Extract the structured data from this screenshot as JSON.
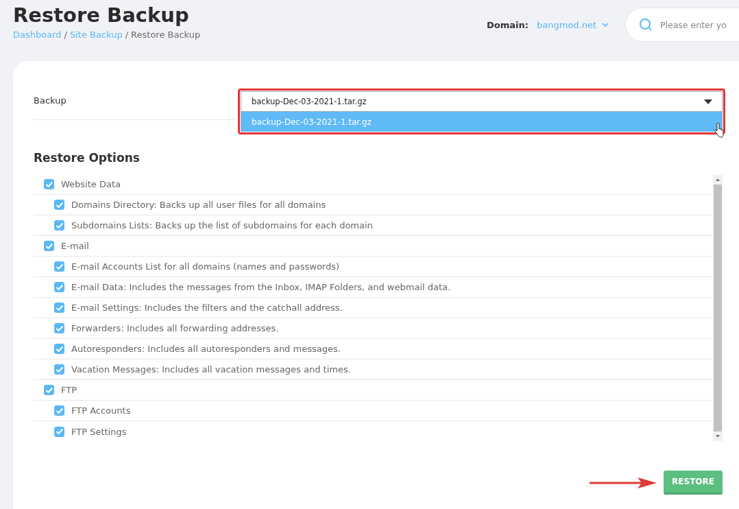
{
  "title": "Restore Backup",
  "breadcrumb": {
    "separator": "/",
    "items": [
      {
        "label": "Dashboard",
        "link": true
      },
      {
        "label": "Site Backup",
        "link": true
      },
      {
        "label": "Restore Backup",
        "link": false
      }
    ]
  },
  "domain": {
    "label": "Domain:",
    "value": "bangmod.net"
  },
  "search": {
    "placeholder": "Please enter yo"
  },
  "backup": {
    "label": "Backup",
    "value": "backup-Dec-03-2021-1.tar.gz",
    "expanded": true,
    "options": [
      {
        "label": "backup-Dec-03-2021-1.tar.gz",
        "selected": true
      }
    ]
  },
  "restore_options": {
    "title": "Restore Options",
    "items": [
      {
        "label": "Website Data",
        "checked": true,
        "children": [
          {
            "label": "Domains Directory: Backs up all user files for all domains",
            "checked": true
          },
          {
            "label": "Subdomains Lists: Backs up the list of subdomains for each domain",
            "checked": true
          }
        ]
      },
      {
        "label": "E-mail",
        "checked": true,
        "children": [
          {
            "label": "E-mail Accounts List for all domains (names and passwords)",
            "checked": true
          },
          {
            "label": "E-mail Data: Includes the messages from the Inbox, IMAP Folders, and webmail data.",
            "checked": true
          },
          {
            "label": "E-mail Settings: Includes the filters and the catchall address.",
            "checked": true
          },
          {
            "label": "Forwarders: Includes all forwarding addresses.",
            "checked": true
          },
          {
            "label": "Autoresponders: Includes all autoresponders and messages.",
            "checked": true
          },
          {
            "label": "Vacation Messages: Includes all vacation messages and times.",
            "checked": true
          }
        ]
      },
      {
        "label": "FTP",
        "checked": true,
        "children": [
          {
            "label": "FTP Accounts",
            "checked": true
          },
          {
            "label": "FTP Settings",
            "checked": true
          }
        ]
      }
    ]
  },
  "restore_button": "RESTORE"
}
